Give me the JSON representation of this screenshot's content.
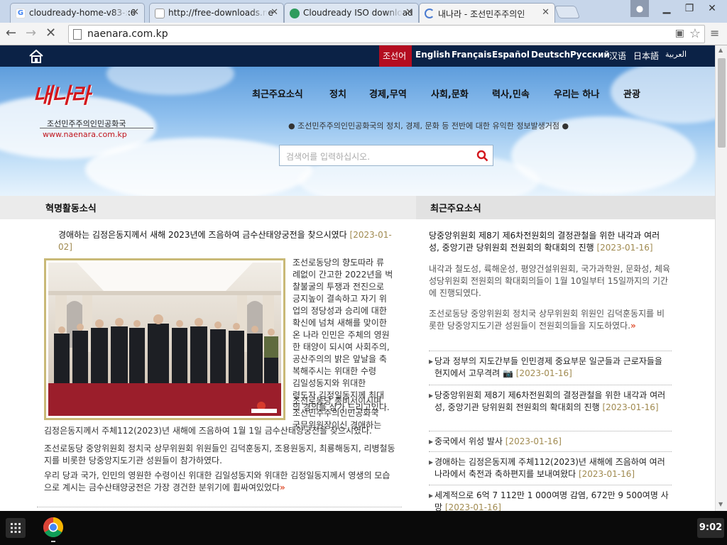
{
  "browser": {
    "tabs": [
      {
        "title": "cloudready-home-v83-x6",
        "favicon_color": "#ffffff",
        "active": false
      },
      {
        "title": "http://free-downloads.ne",
        "favicon_color": "#ffffff",
        "active": false
      },
      {
        "title": "Cloudready ISO download",
        "favicon_color": "#2e9b5d",
        "active": false
      },
      {
        "title": "내나라 - 조선민주주의인",
        "favicon_color": "#ffffff",
        "active": true
      }
    ],
    "url": "naenara.com.kp"
  },
  "site": {
    "languages": [
      "조선어",
      "English",
      "Français",
      "Español",
      "Deutsch",
      "Русский",
      "汉语",
      "日本語",
      "العربية"
    ],
    "logo_text": "내나라",
    "logo_subtitle": "조선민주주의인민공화국",
    "logo_url": "www.naenara.com.kp",
    "nav": [
      "최근주요소식",
      "정치",
      "경제,무역",
      "사회,문화",
      "력사,민속",
      "우리는 하나",
      "관광"
    ],
    "tagline": "조선민주주의인민공화국의 정치, 경제, 문화 등 전반에 대한 유익한 정보발생거점",
    "search_placeholder": "검색어를 입력하십시오.",
    "left_section": {
      "heading": "혁명활동소식",
      "article_title": "경애하는 김정은동지께서 새해 2023년에 즈음하여 금수산태양궁전을 찾으시였다",
      "article_date": "[2023-01-02]",
      "para1_lines": [
        "조선로동당의 향도따라 류",
        "례없이 간고한 2022년을 벅",
        "찰불굴의 투쟁과 전진으로",
        "긍지높이 결속하고 자기 위",
        "업의 정당성과 승리에 대한",
        "확신에 넘쳐 새해를 맞이한",
        "온 나라 인민은 주체의 영원",
        "한 태양이 되시여 사회주의,",
        "공산주의의 밝은 앞날을 축",
        "복해주시는 위대한 수령",
        "김일성동지와 위대한",
        "령도자 김정일동지께 최대",
        "의 경의를 삼가 드리고있다."
      ],
      "para2_lines": [
        "조선로동당 총비서이시며",
        "조선민주주의인민공화국",
        "국무위원장이신 경애하는"
      ],
      "para2_tail": "김정은동지께서 주체112(2023)년 새해에 즈음하여 1월 1일 금수산태양궁전을 찾으시였다.",
      "para3": "조선로동당 중앙위원회 정치국 상무위원회 위원들인 김덕훈동지, 조용원동지, 최룡해동지, 리병철동지를 비롯한 당중앙지도기관 성원들이 참가하였다.",
      "para4": "우리 당과 국가, 인민의 영원한 수령이신 위대한 김일성동지와 위대한 김정일동지께서 영생의 모습으로 계시는 금수산태양궁전은 가장 경건한 분위기에 휩싸여있었다"
    },
    "right_section": {
      "heading": "최근주요소식",
      "lead_title": "당중앙위원회 제8기 제6차전원회의 결정관철을 위한 내각과 여러 성, 중앙기관 당위원회 전원회의 확대회의 진행",
      "lead_date": "[2023-01-16]",
      "lead_p1": "내각과 철도성, 륙해운성, 평양건설위원회, 국가과학원, 문화성, 체육성당위원회 전원회의 확대회의들이 1월 10일부터 15일까지의 기간에 진행되였다.",
      "lead_p2": "조선로동당 중앙위원회 정치국 상무위원회 위원인 김덕훈동지를 비롯한 당중앙지도기관 성원들이 전원회의들을 지도하였다.",
      "items": [
        {
          "text": "당과 정부의 지도간부들 인민경제 중요부문 일군들과 근로자들을 현지에서 고무격려",
          "date": "[2023-01-16]"
        },
        {
          "text": "당중앙위원회 제8기 제6차전원회의 결정관철을 위한 내각과 여러 성, 중앙기관 당위원회 전원회의 확대회의 진행",
          "date": "[2023-01-16]"
        },
        {
          "text": "중국에서 위성 발사",
          "date": "[2023-01-16]"
        },
        {
          "text": "경애하는 김정은동지께 주체112(2023)년 새해에 즈음하여 여러 나라에서 축전과 축하편지를 보내여왔다",
          "date": "[2023-01-16]"
        },
        {
          "text": "세계적으로 6억 7 112만 1 000여명 감염, 672만 9 500여명 사망",
          "date": "[2023-01-16]"
        }
      ]
    }
  },
  "taskbar": {
    "time": "9:02"
  }
}
